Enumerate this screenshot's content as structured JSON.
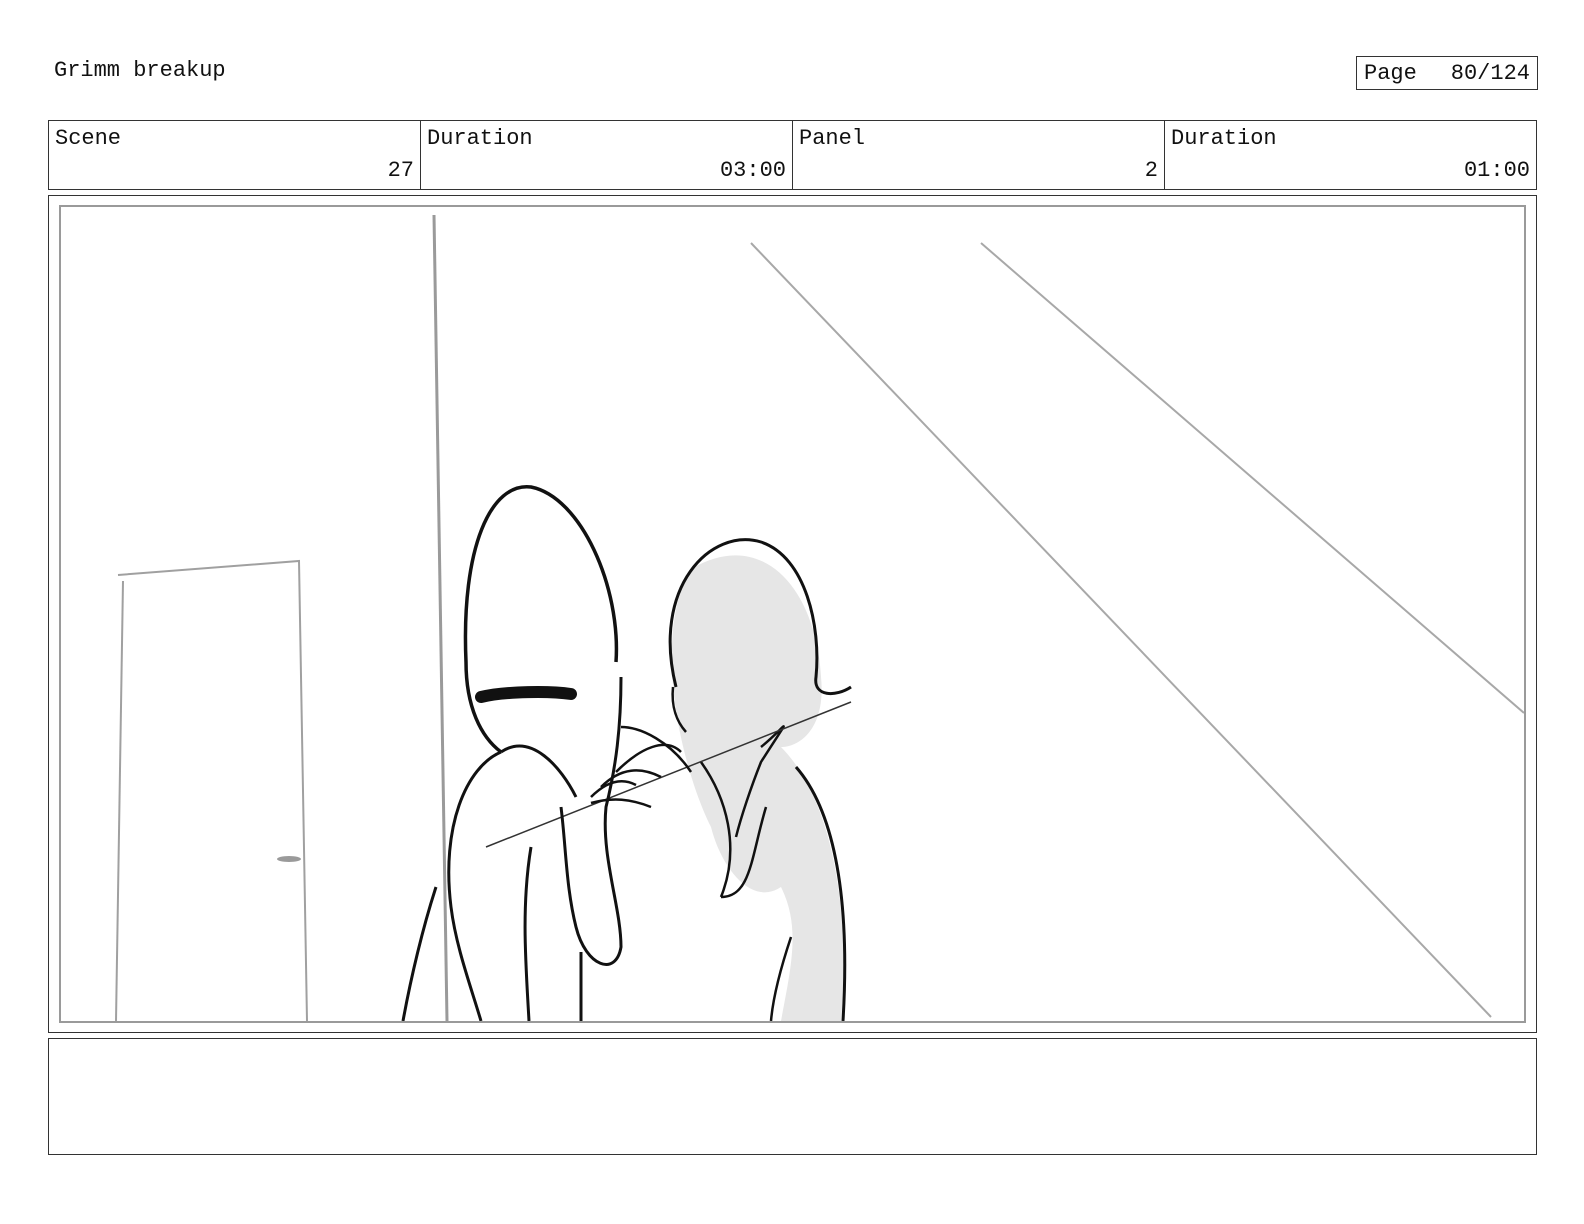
{
  "header": {
    "title": "Grimm breakup",
    "page_label": "Page",
    "page_number": "80/124"
  },
  "info": {
    "scene_label": "Scene",
    "scene_value": "27",
    "scene_duration_label": "Duration",
    "scene_duration_value": "03:00",
    "panel_label": "Panel",
    "panel_value": "2",
    "panel_duration_label": "Duration",
    "panel_duration_value": "01:00"
  },
  "notes": {
    "text": ""
  }
}
